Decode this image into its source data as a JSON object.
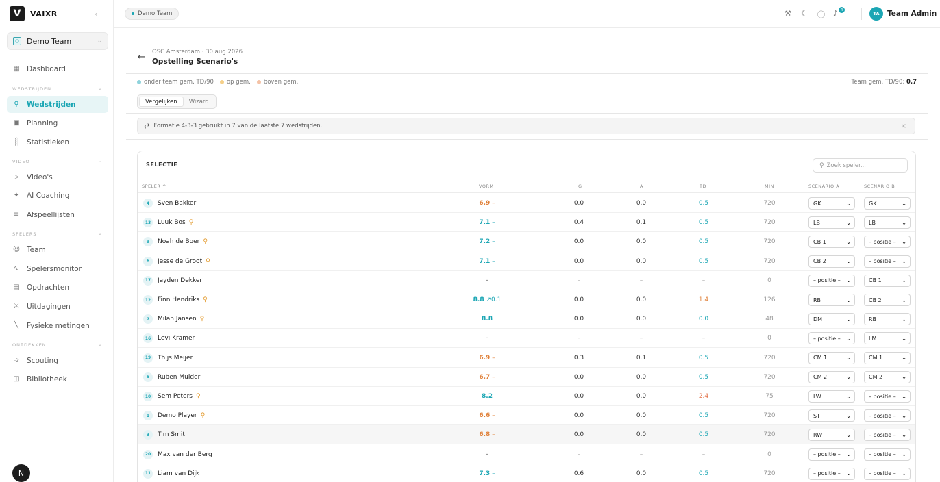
{
  "app": {
    "brand": "VAIXR",
    "logo_glyph": "V",
    "collapse_icon": "‹"
  },
  "sidebar": {
    "team": {
      "name": "Demo Team",
      "icon": "users-icon"
    },
    "dashboard": {
      "label": "Dashboard",
      "icon": "grid-icon"
    },
    "sections": [
      {
        "label": "WEDSTRIJDEN",
        "items": [
          {
            "label": "Wedstrijden",
            "icon": "trophy-icon",
            "active": true
          },
          {
            "label": "Planning",
            "icon": "calendar-icon"
          },
          {
            "label": "Statistieken",
            "icon": "bar-chart-icon"
          }
        ]
      },
      {
        "label": "VIDEO",
        "items": [
          {
            "label": "Video's",
            "icon": "video-icon"
          },
          {
            "label": "AI Coaching",
            "icon": "sparkle-icon"
          },
          {
            "label": "Afspeellijsten",
            "icon": "playlist-icon"
          }
        ]
      },
      {
        "label": "SPELERS",
        "items": [
          {
            "label": "Team",
            "icon": "team-icon"
          },
          {
            "label": "Spelersmonitor",
            "icon": "activity-icon"
          },
          {
            "label": "Opdrachten",
            "icon": "clipboard-icon"
          },
          {
            "label": "Uitdagingen",
            "icon": "swords-icon"
          },
          {
            "label": "Fysieke metingen",
            "icon": "ruler-icon"
          }
        ]
      },
      {
        "label": "ONTDEKKEN",
        "items": [
          {
            "label": "Scouting",
            "icon": "telescope-icon"
          },
          {
            "label": "Bibliotheek",
            "icon": "book-icon"
          }
        ]
      }
    ],
    "bottom_avatar": "N"
  },
  "topbar": {
    "team_chip": "Demo Team",
    "notifications_count": "4",
    "user_initials": "TA",
    "user_name": "Team Admin"
  },
  "page": {
    "subtitle": "OSC Amsterdam · 30 aug 2026",
    "title": "Opstelling Scenario's",
    "legend": [
      {
        "label": "onder team gem. TD/90",
        "color": "#8fd3dc"
      },
      {
        "label": "op gem.",
        "color": "#f5d08a"
      },
      {
        "label": "boven gem.",
        "color": "#f4c2a6"
      }
    ],
    "team_avg_label": "Team gem. TD/90:",
    "team_avg_value": "0.7",
    "tabs": [
      "Vergelijken",
      "Wizard"
    ],
    "banner": "Formatie 4-3-3 gebruikt in 7 van de laatste 7 wedstrijden.",
    "banner_close": "×"
  },
  "table": {
    "title": "SELECTIE",
    "search_placeholder": "Zoek speler...",
    "headers": [
      "SPELER ^",
      "VORM",
      "G",
      "A",
      "TD",
      "MIN",
      "SCENARIO A",
      "SCENARIO B"
    ],
    "colors": {
      "orange": "#e0813a",
      "teal": "#1ba6b4",
      "red": "#e0663a",
      "muted": "#999"
    },
    "rows": [
      {
        "num": "4",
        "name": "Sven Bakker",
        "badge": false,
        "vorm": "6.9",
        "vorm_suffix": " –",
        "vorm_color": "orange",
        "g": "0.0",
        "a": "0.0",
        "td": "0.5",
        "td_color": "teal",
        "min": "720",
        "sa": "GK",
        "sb": "GK"
      },
      {
        "num": "13",
        "name": "Luuk Bos",
        "badge": true,
        "vorm": "7.1",
        "vorm_suffix": " –",
        "vorm_color": "teal",
        "g": "0.4",
        "a": "0.1",
        "td": "0.5",
        "td_color": "teal",
        "min": "720",
        "sa": "LB",
        "sb": "LB"
      },
      {
        "num": "9",
        "name": "Noah de Boer",
        "badge": true,
        "vorm": "7.2",
        "vorm_suffix": " –",
        "vorm_color": "teal",
        "g": "0.0",
        "a": "0.0",
        "td": "0.5",
        "td_color": "teal",
        "min": "720",
        "sa": "CB 1",
        "sb": "– positie –"
      },
      {
        "num": "6",
        "name": "Jesse de Groot",
        "badge": true,
        "vorm": "7.1",
        "vorm_suffix": " –",
        "vorm_color": "teal",
        "g": "0.0",
        "a": "0.0",
        "td": "0.5",
        "td_color": "teal",
        "min": "720",
        "sa": "CB 2",
        "sb": "– positie –"
      },
      {
        "num": "17",
        "name": "Jayden Dekker",
        "badge": false,
        "vorm": "–",
        "vorm_suffix": "",
        "vorm_color": "muted",
        "g": "–",
        "a": "–",
        "td": "–",
        "td_color": "muted",
        "min": "0",
        "sa": "– positie –",
        "sb": "CB 1"
      },
      {
        "num": "12",
        "name": "Finn Hendriks",
        "badge": true,
        "vorm": "8.8",
        "vorm_suffix": " ↗0.1",
        "vorm_color": "teal",
        "g": "0.0",
        "a": "0.0",
        "td": "1.4",
        "td_color": "orange",
        "min": "126",
        "sa": "RB",
        "sb": "CB 2"
      },
      {
        "num": "7",
        "name": "Milan Jansen",
        "badge": true,
        "vorm": "8.8",
        "vorm_suffix": "",
        "vorm_color": "teal",
        "g": "0.0",
        "a": "0.0",
        "td": "0.0",
        "td_color": "teal",
        "min": "48",
        "sa": "DM",
        "sb": "RB"
      },
      {
        "num": "16",
        "name": "Levi Kramer",
        "badge": false,
        "vorm": "–",
        "vorm_suffix": "",
        "vorm_color": "muted",
        "g": "–",
        "a": "–",
        "td": "–",
        "td_color": "muted",
        "min": "0",
        "sa": "– positie –",
        "sb": "LM"
      },
      {
        "num": "19",
        "name": "Thijs Meijer",
        "badge": false,
        "vorm": "6.9",
        "vorm_suffix": " –",
        "vorm_color": "orange",
        "g": "0.3",
        "a": "0.1",
        "td": "0.5",
        "td_color": "teal",
        "min": "720",
        "sa": "CM 1",
        "sb": "CM 1"
      },
      {
        "num": "5",
        "name": "Ruben Mulder",
        "badge": false,
        "vorm": "6.7",
        "vorm_suffix": " –",
        "vorm_color": "orange",
        "g": "0.0",
        "a": "0.0",
        "td": "0.5",
        "td_color": "teal",
        "min": "720",
        "sa": "CM 2",
        "sb": "CM 2"
      },
      {
        "num": "10",
        "name": "Sem Peters",
        "badge": true,
        "vorm": "8.2",
        "vorm_suffix": "",
        "vorm_color": "teal",
        "g": "0.0",
        "a": "0.0",
        "td": "2.4",
        "td_color": "red",
        "min": "75",
        "sa": "LW",
        "sb": "– positie –"
      },
      {
        "num": "1",
        "name": "Demo Player",
        "badge": true,
        "vorm": "6.6",
        "vorm_suffix": " –",
        "vorm_color": "orange",
        "g": "0.0",
        "a": "0.0",
        "td": "0.5",
        "td_color": "teal",
        "min": "720",
        "sa": "ST",
        "sb": "– positie –"
      },
      {
        "num": "3",
        "name": "Tim Smit",
        "badge": false,
        "vorm": "6.8",
        "vorm_suffix": " –",
        "vorm_color": "orange",
        "g": "0.0",
        "a": "0.0",
        "td": "0.5",
        "td_color": "teal",
        "min": "720",
        "sa": "RW",
        "sb": "– positie –",
        "highlight": true
      },
      {
        "num": "20",
        "name": "Max van der Berg",
        "badge": false,
        "vorm": "–",
        "vorm_suffix": "",
        "vorm_color": "muted",
        "g": "–",
        "a": "–",
        "td": "–",
        "td_color": "muted",
        "min": "0",
        "sa": "– positie –",
        "sb": "– positie –"
      },
      {
        "num": "11",
        "name": "Liam van Dijk",
        "badge": false,
        "vorm": "7.3",
        "vorm_suffix": " –",
        "vorm_color": "teal",
        "g": "0.6",
        "a": "0.0",
        "td": "0.5",
        "td_color": "teal",
        "min": "720",
        "sa": "– positie –",
        "sb": "– positie –"
      }
    ]
  }
}
